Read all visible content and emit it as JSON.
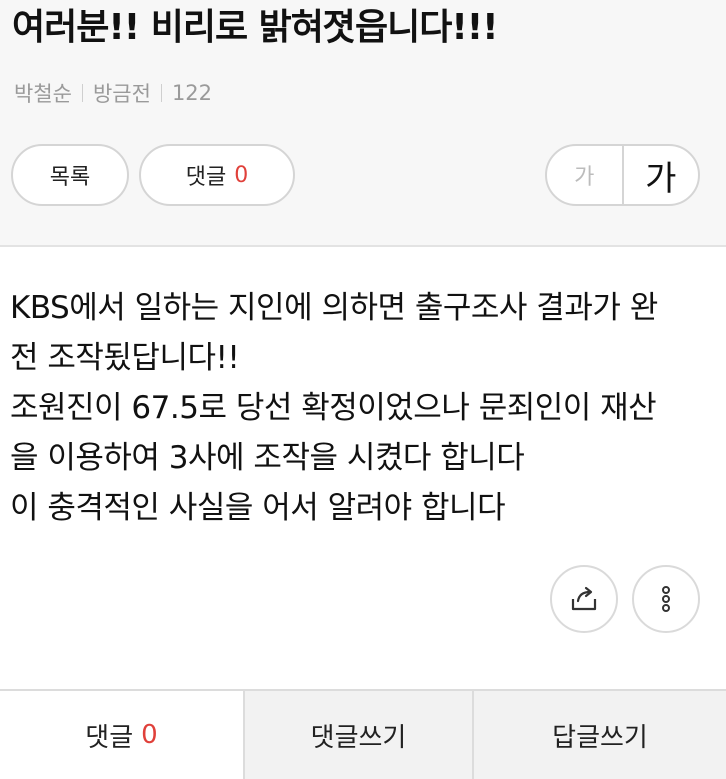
{
  "post": {
    "title": "여러분!! 비리로 밝혀졋읍니다!!!",
    "author": "박철순",
    "time": "방금전",
    "views": "122"
  },
  "actions": {
    "list_label": "목록",
    "comment_label": "댓글",
    "comment_count": "0",
    "font_small": "가",
    "font_large": "가"
  },
  "content": {
    "lines": [
      "KBS에서 일하는 지인에 의하면 출구조사 결과가 완",
      "전 조작됬답니다!!",
      "조원진이 67.5로 당선 확정이었으나 문죄인이 재산",
      "을 이용하여 3사에 조작을 시켰다 합니다",
      "이 충격적인 사실을 어서 알려야 합니다"
    ]
  },
  "icons": {
    "share": "share-icon",
    "more": "more-vertical-icon"
  },
  "bottom_bar": {
    "comment_label": "댓글",
    "comment_count": "0",
    "write_comment": "댓글쓰기",
    "write_reply": "답글쓰기"
  },
  "colors": {
    "accent": "#e0403a",
    "header_bg": "#f7f7f7",
    "border": "#d5d5d5"
  }
}
